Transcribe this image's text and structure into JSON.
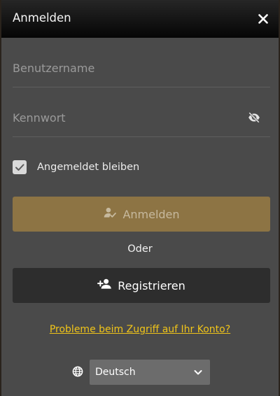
{
  "dialog": {
    "title": "Anmelden",
    "close_icon": "close-icon"
  },
  "form": {
    "username": {
      "placeholder": "Benutzername",
      "value": ""
    },
    "password": {
      "placeholder": "Kennwort",
      "value": "",
      "toggle_icon": "eye-off-icon"
    },
    "remember_me": {
      "label": "Angemeldet bleiben",
      "checked": true
    },
    "login_button": {
      "label": "Anmelden",
      "icon": "user-check-icon"
    },
    "separator": "Oder",
    "register_button": {
      "label": "Registrieren",
      "icon": "user-plus-icon"
    },
    "help_link": "Probleme beim Zugriff auf Ihr Konto?"
  },
  "language": {
    "icon": "globe-icon",
    "selected": "Deutsch",
    "chevron_icon": "chevron-down-icon"
  },
  "colors": {
    "dialog_bg": "#4a4a4a",
    "header_bg": "#050505",
    "login_button_bg": "#8d7444",
    "register_button_bg": "#2d2d2d",
    "link": "#f0c419",
    "select_bg": "#6c6c6c"
  }
}
